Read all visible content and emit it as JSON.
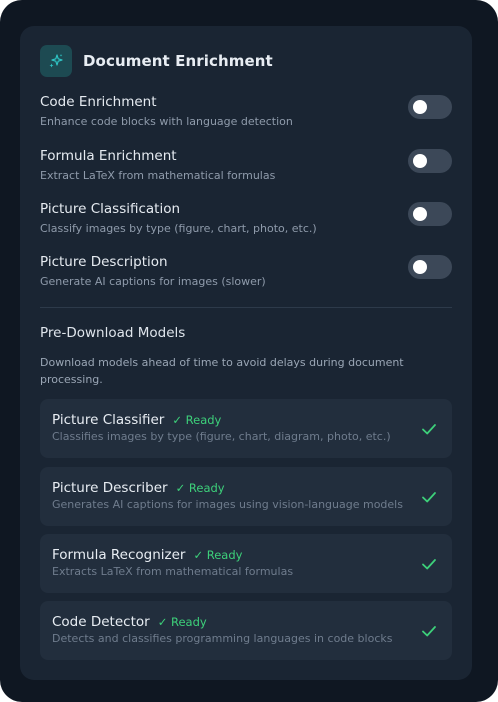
{
  "header": {
    "title": "Document Enrichment",
    "icon": "sparkles-icon",
    "accent": "#2ec4c4"
  },
  "toggles": [
    {
      "title": "Code Enrichment",
      "description": "Enhance code blocks with language detection",
      "enabled": false
    },
    {
      "title": "Formula Enrichment",
      "description": "Extract LaTeX from mathematical formulas",
      "enabled": false
    },
    {
      "title": "Picture Classification",
      "description": "Classify images by type (figure, chart, photo, etc.)",
      "enabled": false
    },
    {
      "title": "Picture Description",
      "description": "Generate AI captions for images (slower)",
      "enabled": false
    }
  ],
  "predownload": {
    "title": "Pre-Download Models",
    "description": "Download models ahead of time to avoid delays during document processing.",
    "models": [
      {
        "name": "Picture Classifier",
        "status": "✓ Ready",
        "description": "Classifies images by type (figure, chart, diagram, photo, etc.)"
      },
      {
        "name": "Picture Describer",
        "status": "✓ Ready",
        "description": "Generates AI captions for images using vision-language models"
      },
      {
        "name": "Formula Recognizer",
        "status": "✓ Ready",
        "description": "Extracts LaTeX from mathematical formulas"
      },
      {
        "name": "Code Detector",
        "status": "✓ Ready",
        "description": "Detects and classifies programming languages in code blocks"
      }
    ]
  },
  "colors": {
    "ready": "#3dd07a",
    "toggle_off": "#3c4858",
    "panel": "#1a2533"
  }
}
